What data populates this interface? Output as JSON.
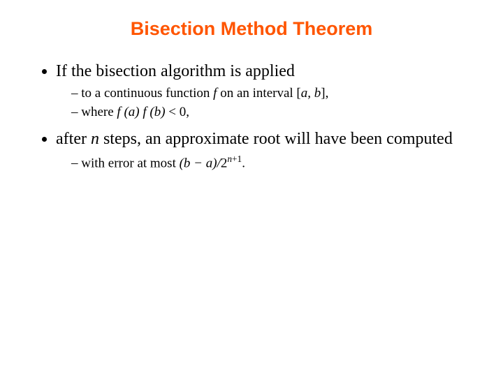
{
  "title": "Bisection Method Theorem",
  "bullets": {
    "b1": "If the bisection algorithm is applied",
    "b1_sub1_a": "to a continuous function ",
    "b1_sub1_f": "f",
    "b1_sub1_b": " on an interval [",
    "b1_sub1_ab": "a, b",
    "b1_sub1_c": "],",
    "b1_sub2_a": "where ",
    "b1_sub2_fa": "f (a) f (b)",
    "b1_sub2_b": " < 0,",
    "b2_a": "after ",
    "b2_n": "n",
    "b2_b": " steps, an approximate root will have been computed",
    "b2_sub1_a": "with error at most ",
    "b2_sub1_expr_open": "(b − a)/",
    "b2_sub1_two": "2",
    "b2_sub1_sup_n": "n",
    "b2_sub1_sup_plus1": "+1",
    "b2_sub1_period": "."
  }
}
